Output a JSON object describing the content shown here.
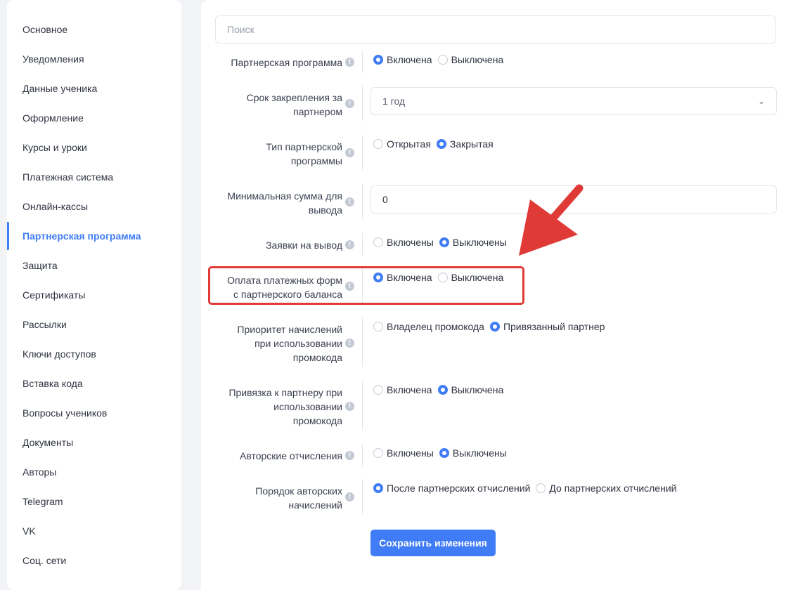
{
  "sidebar": {
    "items": [
      {
        "label": "Основное"
      },
      {
        "label": "Уведомления"
      },
      {
        "label": "Данные ученика"
      },
      {
        "label": "Оформление"
      },
      {
        "label": "Курсы и уроки"
      },
      {
        "label": "Платежная система"
      },
      {
        "label": "Онлайн-кассы"
      },
      {
        "label": "Партнерская программа",
        "active": true
      },
      {
        "label": "Защита"
      },
      {
        "label": "Сертификаты"
      },
      {
        "label": "Рассылки"
      },
      {
        "label": "Ключи доступов"
      },
      {
        "label": "Вставка кода"
      },
      {
        "label": "Вопросы учеников"
      },
      {
        "label": "Документы"
      },
      {
        "label": "Авторы"
      },
      {
        "label": "Telegram"
      },
      {
        "label": "VK"
      },
      {
        "label": "Соц. сети"
      }
    ]
  },
  "search": {
    "placeholder": "Поиск",
    "value": ""
  },
  "settings": {
    "partner_program": {
      "label": "Партнерская программа",
      "options": [
        "Включена",
        "Выключена"
      ],
      "selected": 0
    },
    "binding_period": {
      "label_line1": "Срок закрепления за",
      "label_line2": "партнером",
      "value": "1 год"
    },
    "program_type": {
      "label_line1": "Тип партнерской",
      "label_line2": "программы",
      "options": [
        "Открытая",
        "Закрытая"
      ],
      "selected": 1
    },
    "min_withdrawal": {
      "label_line1": "Минимальная сумма для",
      "label_line2": "вывода",
      "value": "0"
    },
    "withdrawal_requests": {
      "label": "Заявки на вывод",
      "options": [
        "Включены",
        "Выключены"
      ],
      "selected": 1
    },
    "pay_from_balance": {
      "label_line1": "Оплата платежных форм",
      "label_line2": "с партнерского баланса",
      "options": [
        "Включена",
        "Выключена"
      ],
      "selected": 0
    },
    "accrual_priority": {
      "label_line1": "Приоритет начислений",
      "label_line2": "при использовании",
      "label_line3": "промокода",
      "options": [
        "Владелец промокода",
        "Привязанный партнер"
      ],
      "selected": 1
    },
    "promo_binding": {
      "label_line1": "Привязка к партнеру при",
      "label_line2": "использовании",
      "label_line3": "промокода",
      "options": [
        "Включена",
        "Выключена"
      ],
      "selected": 1
    },
    "author_fees": {
      "label": "Авторские отчисления",
      "options": [
        "Включены",
        "Выключены"
      ],
      "selected": 1
    },
    "author_order": {
      "label_line1": "Порядок авторских",
      "label_line2": "начислений",
      "options": [
        "После партнерских отчислений",
        "До партнерских отчислений"
      ],
      "selected": 0
    }
  },
  "save_button": {
    "label": "Сохранить изменения"
  },
  "info_glyph": "!",
  "chevron_glyph": "⌄",
  "colors": {
    "accent": "#3f7cf5",
    "annotation": "#e03a36",
    "background": "#f2f3f6"
  }
}
